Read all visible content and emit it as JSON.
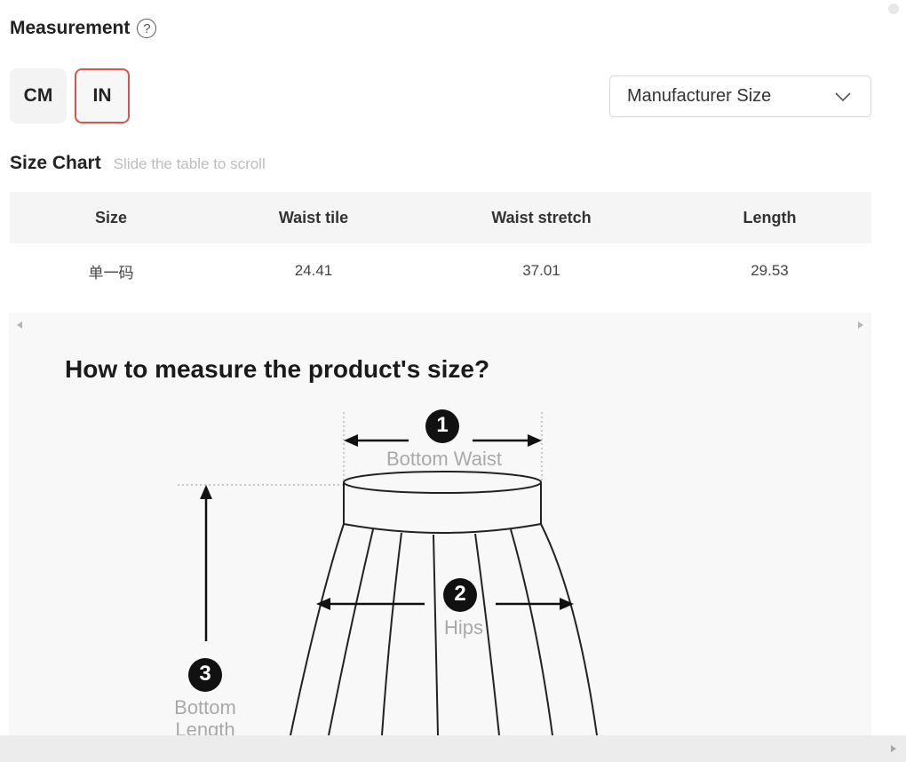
{
  "header": {
    "title": "Measurement",
    "help_icon": "question-circle-icon"
  },
  "units": {
    "cm_label": "CM",
    "in_label": "IN",
    "selected": "IN",
    "selected_color": "#d9534f"
  },
  "size_select": {
    "value": "Manufacturer Size",
    "icon": "chevron-down-icon"
  },
  "size_chart": {
    "title": "Size Chart",
    "hint": "Slide the table to scroll",
    "columns": [
      "Size",
      "Waist tile",
      "Waist stretch",
      "Length"
    ],
    "rows": [
      [
        "单一码",
        "24.41",
        "37.01",
        "29.53"
      ]
    ]
  },
  "guide": {
    "title": "How to measure the product's size?",
    "markers": [
      {
        "number": "1",
        "label": "Bottom Waist"
      },
      {
        "number": "2",
        "label": "Hips"
      },
      {
        "number": "3",
        "label_line1": "Bottom",
        "label_line2": "Length"
      }
    ]
  }
}
